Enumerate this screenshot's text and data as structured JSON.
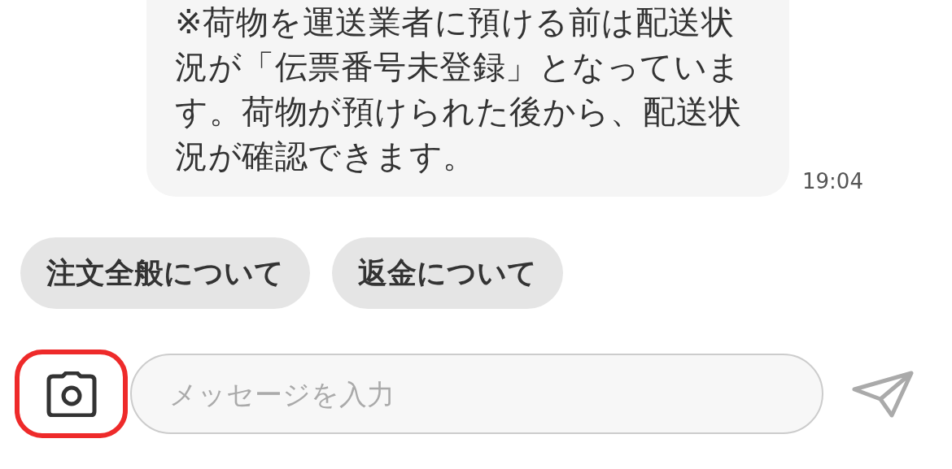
{
  "message": {
    "text": "※荷物を運送業者に預ける前は配送状況が「伝票番号未登録」となっています。荷物が預けられた後から、配送状況が確認できます。",
    "time": "19:04"
  },
  "quick_replies": [
    {
      "label": "注文全般について"
    },
    {
      "label": "返金について"
    }
  ],
  "composer": {
    "camera_highlighted": true,
    "placeholder": "メッセージを入力"
  }
}
